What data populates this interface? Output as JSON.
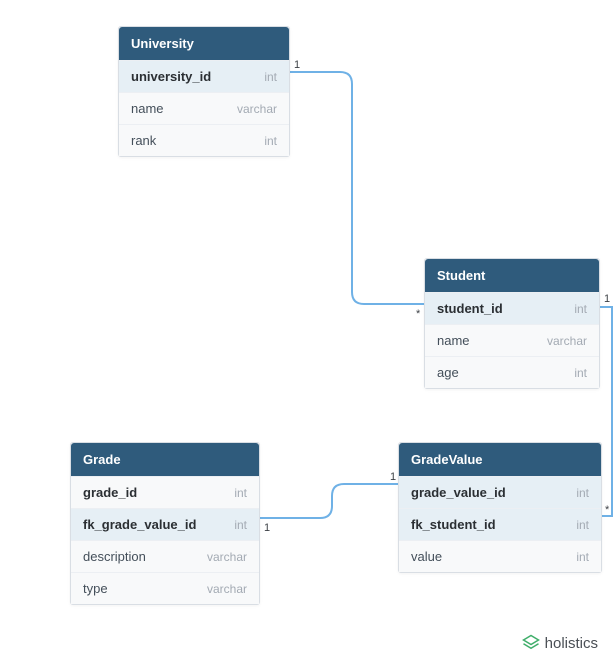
{
  "entities": {
    "university": {
      "title": "University",
      "fields": [
        {
          "name": "university_id",
          "type": "int"
        },
        {
          "name": "name",
          "type": "varchar"
        },
        {
          "name": "rank",
          "type": "int"
        }
      ]
    },
    "student": {
      "title": "Student",
      "fields": [
        {
          "name": "student_id",
          "type": "int"
        },
        {
          "name": "name",
          "type": "varchar"
        },
        {
          "name": "age",
          "type": "int"
        }
      ]
    },
    "grade": {
      "title": "Grade",
      "fields": [
        {
          "name": "grade_id",
          "type": "int"
        },
        {
          "name": "fk_grade_value_id",
          "type": "int"
        },
        {
          "name": "description",
          "type": "varchar"
        },
        {
          "name": "type",
          "type": "varchar"
        }
      ]
    },
    "gradevalue": {
      "title": "GradeValue",
      "fields": [
        {
          "name": "grade_value_id",
          "type": "int"
        },
        {
          "name": "fk_student_id",
          "type": "int"
        },
        {
          "name": "value",
          "type": "int"
        }
      ]
    }
  },
  "cardinalities": {
    "uni_one": "1",
    "student_many": "*",
    "student_one": "1",
    "gv_fk_many": "*",
    "grade_fk_one": "1",
    "gv_pk_one": "1"
  },
  "brand": "holistics",
  "chart_data": {
    "type": "table",
    "description": "Entity-relationship diagram with four tables and three relationships.",
    "tables": [
      {
        "name": "University",
        "columns": [
          {
            "name": "university_id",
            "type": "int",
            "pk": true
          },
          {
            "name": "name",
            "type": "varchar"
          },
          {
            "name": "rank",
            "type": "int"
          }
        ]
      },
      {
        "name": "Student",
        "columns": [
          {
            "name": "student_id",
            "type": "int",
            "pk": true
          },
          {
            "name": "name",
            "type": "varchar"
          },
          {
            "name": "age",
            "type": "int"
          }
        ]
      },
      {
        "name": "Grade",
        "columns": [
          {
            "name": "grade_id",
            "type": "int",
            "pk": true
          },
          {
            "name": "fk_grade_value_id",
            "type": "int",
            "fk": true
          },
          {
            "name": "description",
            "type": "varchar"
          },
          {
            "name": "type",
            "type": "varchar"
          }
        ]
      },
      {
        "name": "GradeValue",
        "columns": [
          {
            "name": "grade_value_id",
            "type": "int",
            "pk": true
          },
          {
            "name": "fk_student_id",
            "type": "int",
            "fk": true
          },
          {
            "name": "value",
            "type": "int"
          }
        ]
      }
    ],
    "relationships": [
      {
        "from": "University.university_id",
        "to": "Student",
        "type": "1-to-many"
      },
      {
        "from": "Student.student_id",
        "to": "GradeValue.fk_student_id",
        "type": "1-to-many"
      },
      {
        "from": "GradeValue.grade_value_id",
        "to": "Grade.fk_grade_value_id",
        "type": "1-to-many"
      }
    ]
  }
}
